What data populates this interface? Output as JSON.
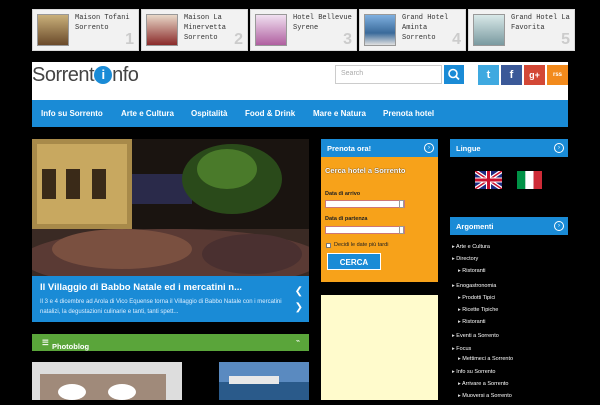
{
  "hotels": [
    {
      "name": "Maison Tofani\nSorrento",
      "num": "1"
    },
    {
      "name": "Maison La\nMinervetta\nSorrento",
      "num": "2"
    },
    {
      "name": "Hotel Bellevue\nSyrene",
      "num": "3"
    },
    {
      "name": "Grand Hotel\nAminta\nSorrento",
      "num": "4"
    },
    {
      "name": "Grand Hotel La\nFavorita",
      "num": "5"
    }
  ],
  "logo": {
    "prefix": "Sorrent",
    "mark": "i",
    "suffix": "nfo"
  },
  "search": {
    "placeholder": "Search"
  },
  "social": {
    "twitter": "t",
    "facebook": "f",
    "gplus": "g+",
    "rss": "rss"
  },
  "nav": [
    "Info su Sorrento",
    "Arte e Cultura",
    "Ospitalità",
    "Food & Drink",
    "Mare e Natura",
    "Prenota hotel"
  ],
  "slider": {
    "title": "Il Villaggio di Babbo Natale ed i mercatini n...",
    "desc": "Il 3 e 4 dicembre ad Arola di Vico Equense torna il Villaggio di Babbo Natale con i mercatini natalizi, la degustazioni culinarie e tanti, tanti spett..."
  },
  "photoblog": {
    "title": "Photoblog"
  },
  "prenota": {
    "header": "Prenota ora!",
    "subtitle": "Cerca hotel a Sorrento",
    "arrival": "Data di arrivo",
    "departure": "Data di partenza",
    "later": "Decidi le date più tardi",
    "button": "CERCA"
  },
  "lingue": {
    "header": "Lingue"
  },
  "argomenti": {
    "header": "Argomenti",
    "items": [
      {
        "label": "Arte e Cultura",
        "level": 0
      },
      {
        "label": "Directory",
        "level": 0
      },
      {
        "label": "Ristoranti",
        "level": 1
      },
      {
        "label": "Enogastronomia",
        "level": 0
      },
      {
        "label": "Prodotti Tipici",
        "level": 1
      },
      {
        "label": "Ricette Tipiche",
        "level": 1
      },
      {
        "label": "Ristoranti",
        "level": 1
      },
      {
        "label": "Eventi a Sorrento",
        "level": 0
      },
      {
        "label": "Focus",
        "level": 0
      },
      {
        "label": "Mettimeci a Sorrento",
        "level": 1
      },
      {
        "label": "Info su Sorrento",
        "level": 0
      },
      {
        "label": "Arrivare a Sorrento",
        "level": 1
      },
      {
        "label": "Muoversi a Sorrento",
        "level": 1
      }
    ]
  },
  "colors": {
    "accent": "#1a8bd6",
    "orange": "#f7a21a",
    "green": "#5aa53a"
  }
}
